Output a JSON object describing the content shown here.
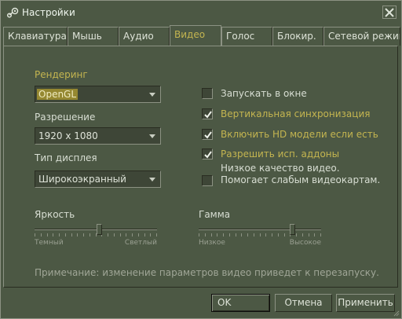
{
  "window": {
    "title": "Настройки",
    "icon": "steam-icon",
    "close_icon": "close-icon"
  },
  "tabs": [
    {
      "label": "Клавиатура",
      "active": false
    },
    {
      "label": "Мышь",
      "active": false
    },
    {
      "label": "Аудио",
      "active": false
    },
    {
      "label": "Видео",
      "active": true
    },
    {
      "label": "Голос",
      "active": false
    },
    {
      "label": "Блокир.",
      "active": false
    },
    {
      "label": "Сетевой режим",
      "active": false
    }
  ],
  "video": {
    "rendering": {
      "label": "Рендеринг",
      "value": "OpenGL"
    },
    "resolution": {
      "label": "Разрешение",
      "value": "1920 x 1080"
    },
    "display": {
      "label": "Тип дисплея",
      "value": "Широкоэкранный"
    },
    "checkboxes": [
      {
        "label": "Запускать в окне",
        "checked": false,
        "highlight": false
      },
      {
        "label": "Вертикальная синхронизация",
        "checked": true,
        "highlight": true
      },
      {
        "label": "Включить HD модели если есть",
        "checked": true,
        "highlight": true
      },
      {
        "label": "Разрешить исп. аддоны",
        "checked": true,
        "highlight": true
      }
    ],
    "low_quality": {
      "line1": "Низкое качество видео.",
      "line2": "Помогает слабым видеокартам.",
      "checked": false
    },
    "brightness": {
      "label": "Яркость",
      "min_label": "Темный",
      "max_label": "Светлый",
      "level": 0.53
    },
    "gamma": {
      "label": "Гамма",
      "min_label": "Низкое",
      "max_label": "Высокое",
      "level": 0.78
    },
    "note": "Примечание: изменение параметров видео приведет к перезапуску."
  },
  "buttons": {
    "ok": "OK",
    "cancel": "Отмена",
    "apply": "Применить"
  },
  "colors": {
    "background": "#4c5844",
    "accent": "#c4b550",
    "text": "#d8ded3"
  }
}
